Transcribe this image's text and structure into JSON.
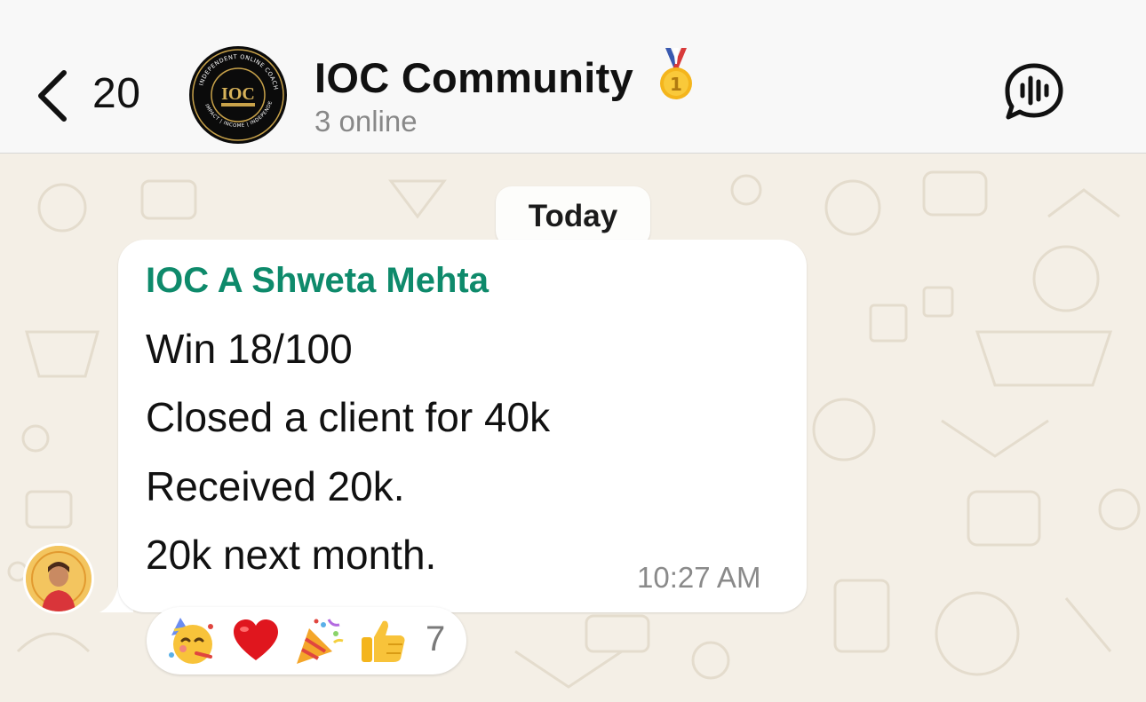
{
  "header": {
    "back_icon": "chevron-left-icon",
    "unread_count": "20",
    "group_avatar_icon": "ioc-logo",
    "title": "IOC Community",
    "title_badge_icon": "first-place-medal-icon",
    "subtitle": "3 online",
    "voice_chat_icon": "voice-chat-icon"
  },
  "chat": {
    "date_separator": "Today",
    "message": {
      "sender": "IOC A Shweta Mehta",
      "sender_color": "#0e8a6b",
      "lines": [
        "Win 18/100",
        "Closed a client for 40k",
        "Received 20k.",
        "20k next month."
      ],
      "time": "10:27 AM",
      "sender_avatar_icon": "train-with-shweta-avatar"
    },
    "reactions": {
      "emojis": [
        "partying-face",
        "red-heart",
        "party-popper",
        "thumbs-up"
      ],
      "count": "7"
    }
  },
  "colors": {
    "header_bg": "#f8f8f8",
    "wallpaper": "#f4efe6",
    "bubble": "#ffffff"
  }
}
